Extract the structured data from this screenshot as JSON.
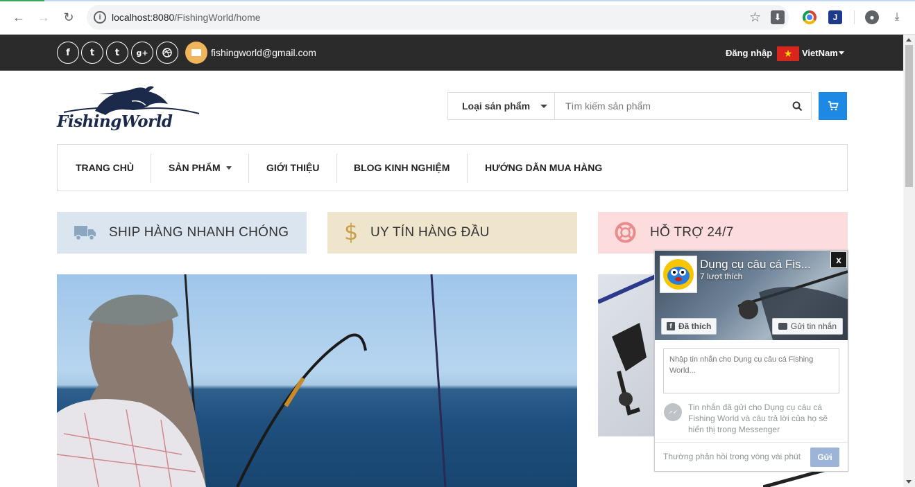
{
  "browser": {
    "url_host": "localhost:8080",
    "url_path": "/FishingWorld/home"
  },
  "topbar": {
    "social": [
      "f",
      "t",
      "t",
      "g+",
      "dribbble"
    ],
    "email": "fishingworld@gmail.com",
    "login": "Đăng nhập",
    "language": "VietNam"
  },
  "header": {
    "logo_text": "FishingWorld",
    "category_label": "Loại sản phẩm",
    "search_placeholder": "Tìm kiếm sản phẩm"
  },
  "nav": {
    "items": [
      "TRANG CHỦ",
      "SẢN PHẨM",
      "GIỚI THIỆU",
      "BLOG KINH NGHIỆM",
      "HƯỚNG DẪN MUA HÀNG"
    ]
  },
  "features": [
    {
      "label": "SHIP HÀNG NHANH CHÓNG",
      "icon": "truck-icon",
      "color": "#8aa6c0"
    },
    {
      "label": "UY TÍN HÀNG ĐẦU",
      "icon": "dollar-icon",
      "color": "#c9a04a"
    },
    {
      "label": "HỖ TRỢ 24/7",
      "icon": "lifebuoy-icon",
      "color": "#e98c8c"
    }
  ],
  "fb_widget": {
    "close": "x",
    "page_title": "Dụng cụ câu cá Fis...",
    "likes": "7 lượt thích",
    "liked_button": "Đã thích",
    "message_button": "Gửi tin nhắn",
    "textarea_placeholder": "Nhập tin nhắn cho Dụng cụ câu cá Fishing World...",
    "info_text": "Tin nhắn đã gửi cho Dụng cụ câu cá Fishing World và câu trả lời của họ sẽ hiển thị trong Messenger",
    "reply_note": "Thường phản hồi trong vòng vài phút",
    "send_button": "Gửi"
  },
  "colors": {
    "topbar_bg": "#2b2b2b",
    "cart_blue": "#1e88e5",
    "mail_orange": "#f0b45a"
  }
}
